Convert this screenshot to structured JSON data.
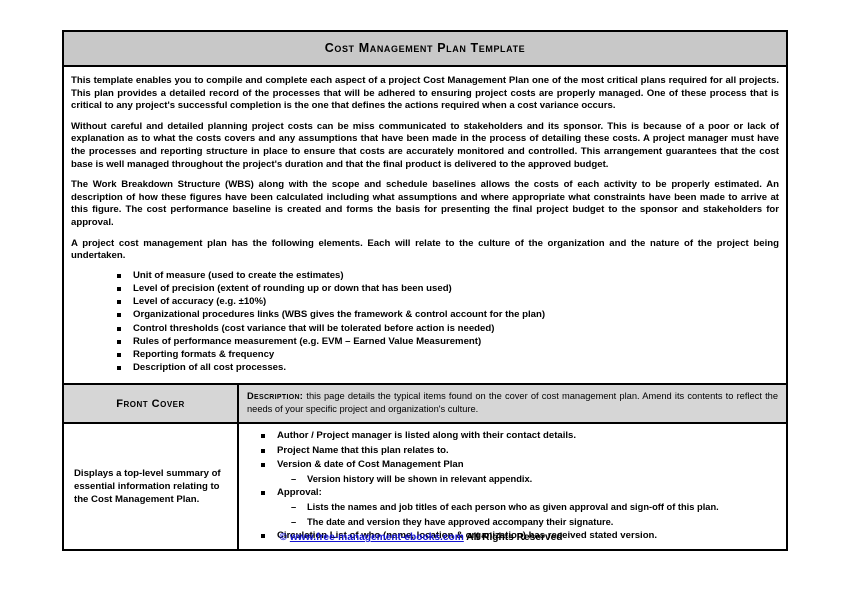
{
  "document": {
    "title": "Cost Management Plan Template",
    "paragraphs": [
      "This template enables you to compile and complete each aspect of a project Cost Management Plan one of the most critical plans required for all projects. This plan provides a detailed record of the processes that will be adhered to ensuring project costs are properly managed. One of these process that is critical to any project's successful completion is the one that defines the actions required when a cost variance occurs.",
      "Without careful and detailed planning project costs can be miss communicated to stakeholders and its sponsor. This is because of a poor or lack of explanation as to what the costs covers and any assumptions that have been made in the process of detailing these costs. A project manager must have the processes and reporting structure in place to ensure that costs are accurately monitored and controlled. This arrangement guarantees that the cost base is well managed throughout the project's duration and that the final product is delivered to the approved budget.",
      "The Work Breakdown Structure (WBS) along with the scope and schedule baselines allows the costs of each activity to be properly estimated. An description of how these figures have been calculated including what assumptions and where appropriate what constraints have been made to arrive at this figure. The cost performance baseline is created and forms the basis for presenting the final project budget to the sponsor and stakeholders for approval.",
      "A project cost management plan has the following elements. Each will relate to the culture of the organization and the nature of the project being undertaken."
    ],
    "elements_list": [
      "Unit of measure (used to create the estimates)",
      "Level of precision (extent of rounding up or down that has been used)",
      "Level of accuracy (e.g. ±10%)",
      "Organizational procedures links (WBS gives the framework & control account for the plan)",
      "Control thresholds (cost variance that will be tolerated before action is needed)",
      "Rules of performance measurement (e.g. EVM – Earned Value Measurement)",
      "Reporting formats & frequency",
      "Description of all cost processes."
    ],
    "table": {
      "section_label": "Front Cover",
      "description_keyword": "Description:",
      "description_text": " this page details the typical items found on the cover of cost management plan. Amend its contents to reflect the needs of your specific project and organization's culture.",
      "summary_text": "Displays a top-level summary of essential information relating to the Cost Management Plan.",
      "details": [
        {
          "text": "Author / Project manager is listed along with their contact details.",
          "sub": []
        },
        {
          "text": "Project Name that this plan relates to.",
          "sub": []
        },
        {
          "text": "Version & date of Cost Management Plan",
          "sub": [
            "Version history will be shown in relevant appendix."
          ]
        },
        {
          "text": "Approval:",
          "sub": [
            "Lists the names and job titles of each person who as given approval and sign-off of this plan.",
            "The date and version they have approved accompany their signature."
          ]
        },
        {
          "text": "Circulation List of who (name, location & organization) has received stated version.",
          "sub": []
        }
      ]
    }
  },
  "footer": {
    "copyright_symbol": "©",
    "link_text": "www.free-management-ebooks.com",
    "rights_text": "All Rights Reserved"
  },
  "colors": {
    "title_bar": "#c8c8c8",
    "cell_shade": "#d6d6d6",
    "border": "#000000",
    "link": "#1414d2"
  }
}
